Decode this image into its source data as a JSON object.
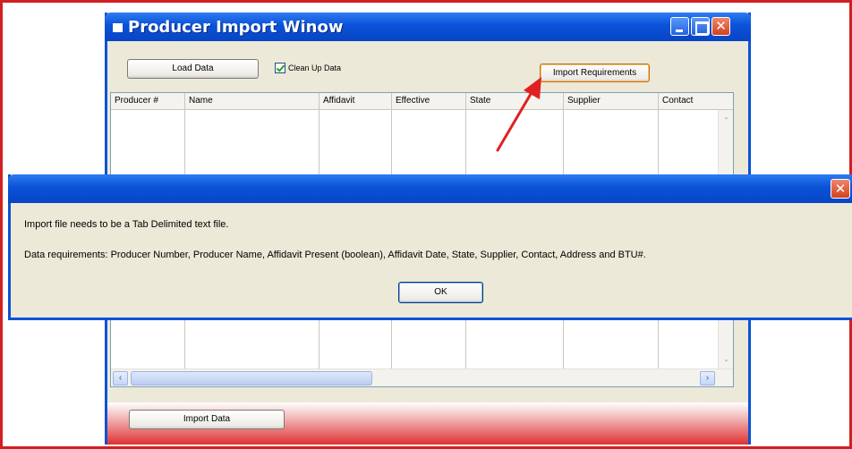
{
  "window": {
    "title": "Producer Import Winow",
    "load_button": "Load Data",
    "cleanup_checkbox": {
      "label": "Clean Up Data",
      "checked": true
    },
    "import_requirements_button": "Import Requirements",
    "import_data_button": "Import Data",
    "grid": {
      "columns": [
        "Producer #",
        "Name",
        "Affidavit",
        "Effective",
        "State",
        "Supplier",
        "Contact"
      ]
    }
  },
  "dialog": {
    "message_line1": "Import file needs to be a Tab Delimited text file.",
    "message_line2": "Data requirements: Producer Number, Producer Name, Affidavit Present (boolean), Affidavit Date, State, Supplier, Contact, Address and BTU#.",
    "ok_button": "OK"
  },
  "colors": {
    "highlight_border": "#d22020",
    "annotation_arrow": "#e02020",
    "xp_titlebar": "#0a52d8"
  }
}
